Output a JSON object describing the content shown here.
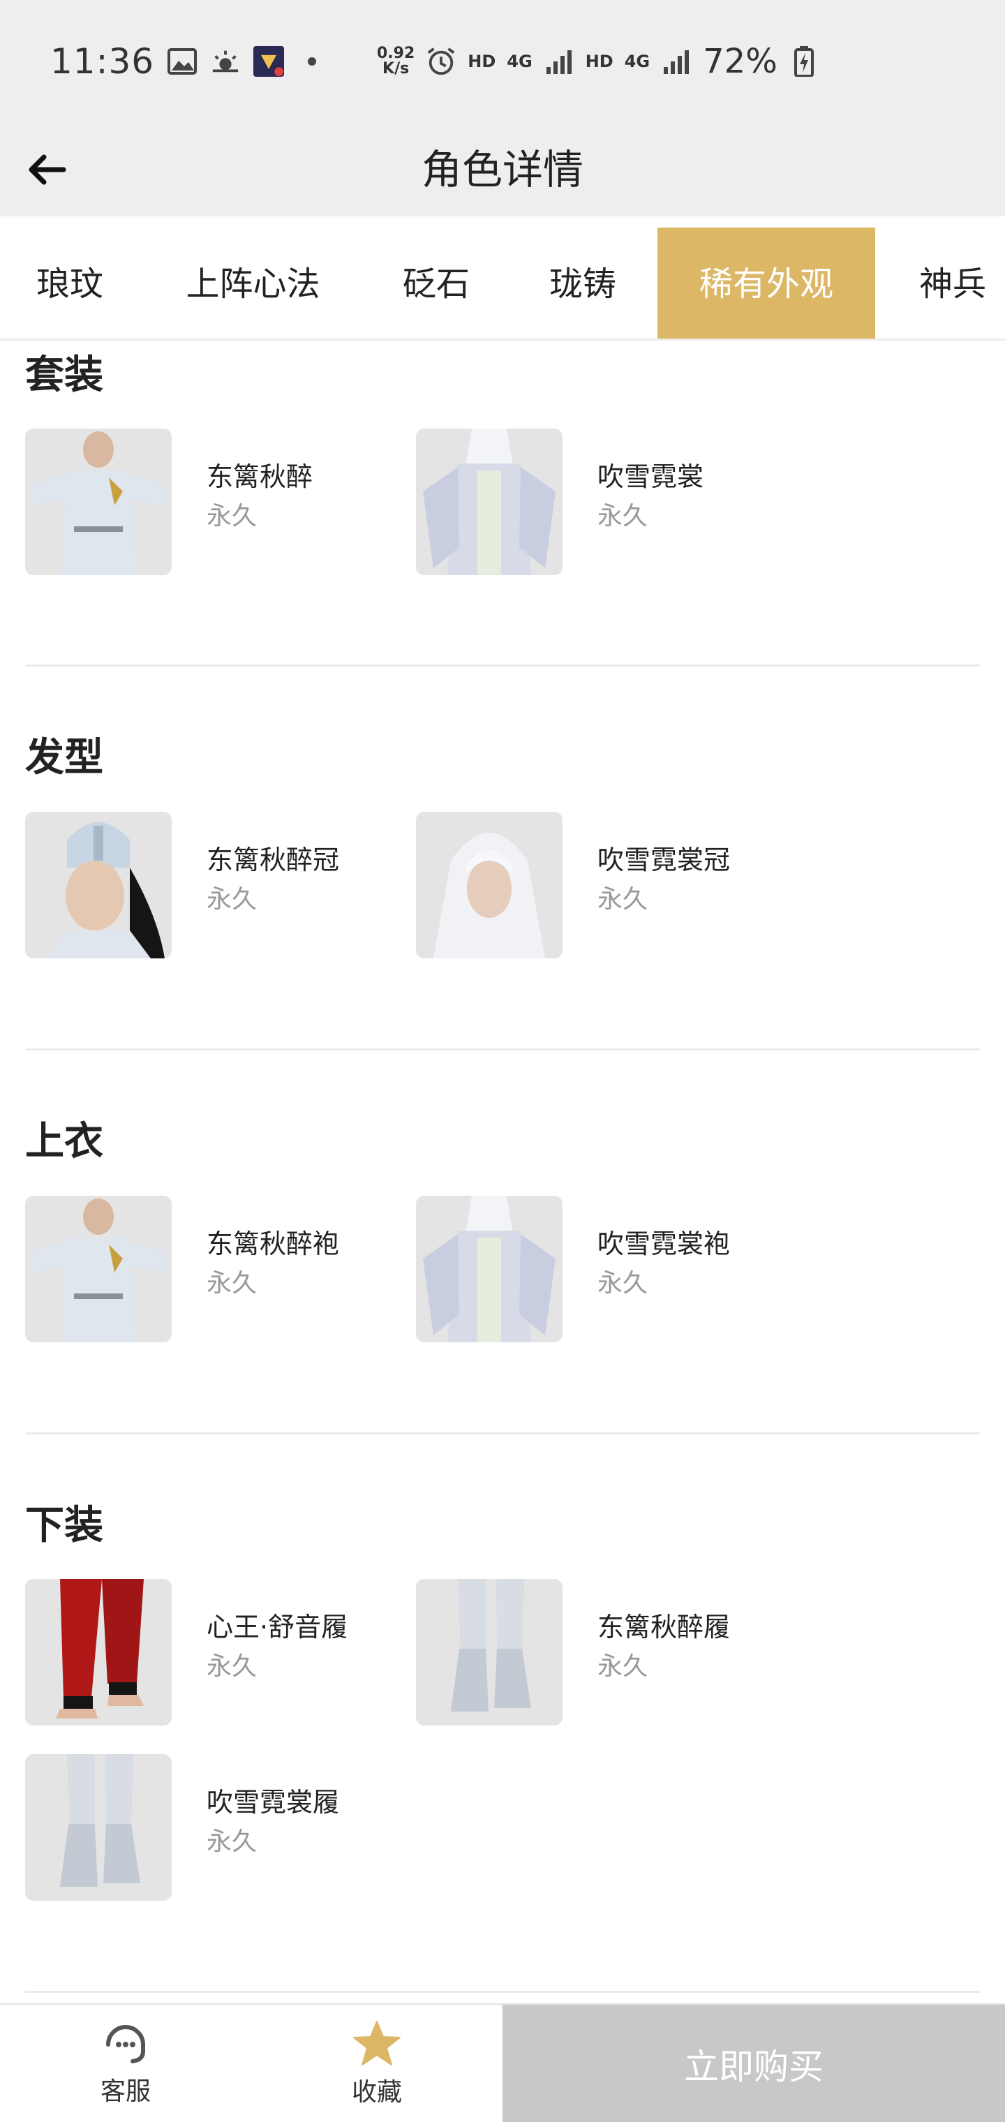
{
  "status_bar": {
    "time": "11:36",
    "net_speed_value": "0.92",
    "net_speed_unit": "K/s",
    "hd1": "HD",
    "hd2": "HD",
    "net1": "4G",
    "net2": "4G",
    "battery": "72%"
  },
  "header": {
    "title": "角色详情"
  },
  "tabs": [
    {
      "label": "琅玟",
      "active": false
    },
    {
      "label": "上阵心法",
      "active": false
    },
    {
      "label": "砭石",
      "active": false
    },
    {
      "label": "珑铸",
      "active": false
    },
    {
      "label": "稀有外观",
      "active": true
    },
    {
      "label": "神兵",
      "active": false
    }
  ],
  "sections": [
    {
      "title": "套装",
      "items": [
        {
          "name": "东篱秋醉",
          "duration": "永久"
        },
        {
          "name": "吹雪霓裳",
          "duration": "永久"
        }
      ]
    },
    {
      "title": "发型",
      "items": [
        {
          "name": "东篱秋醉冠",
          "duration": "永久"
        },
        {
          "name": "吹雪霓裳冠",
          "duration": "永久"
        }
      ]
    },
    {
      "title": "上衣",
      "items": [
        {
          "name": "东篱秋醉袍",
          "duration": "永久"
        },
        {
          "name": "吹雪霓裳袍",
          "duration": "永久"
        }
      ]
    },
    {
      "title": "下装",
      "items": [
        {
          "name": "心王·舒音履",
          "duration": "永久"
        },
        {
          "name": "东篱秋醉履",
          "duration": "永久"
        },
        {
          "name": "吹雪霓裳履",
          "duration": "永久"
        }
      ]
    }
  ],
  "bottom_bar": {
    "service_label": "客服",
    "favorite_label": "收藏",
    "buy_label": "立即购买"
  },
  "colors": {
    "accent": "#dcb766",
    "buy_disabled": "#c8c8c8"
  }
}
